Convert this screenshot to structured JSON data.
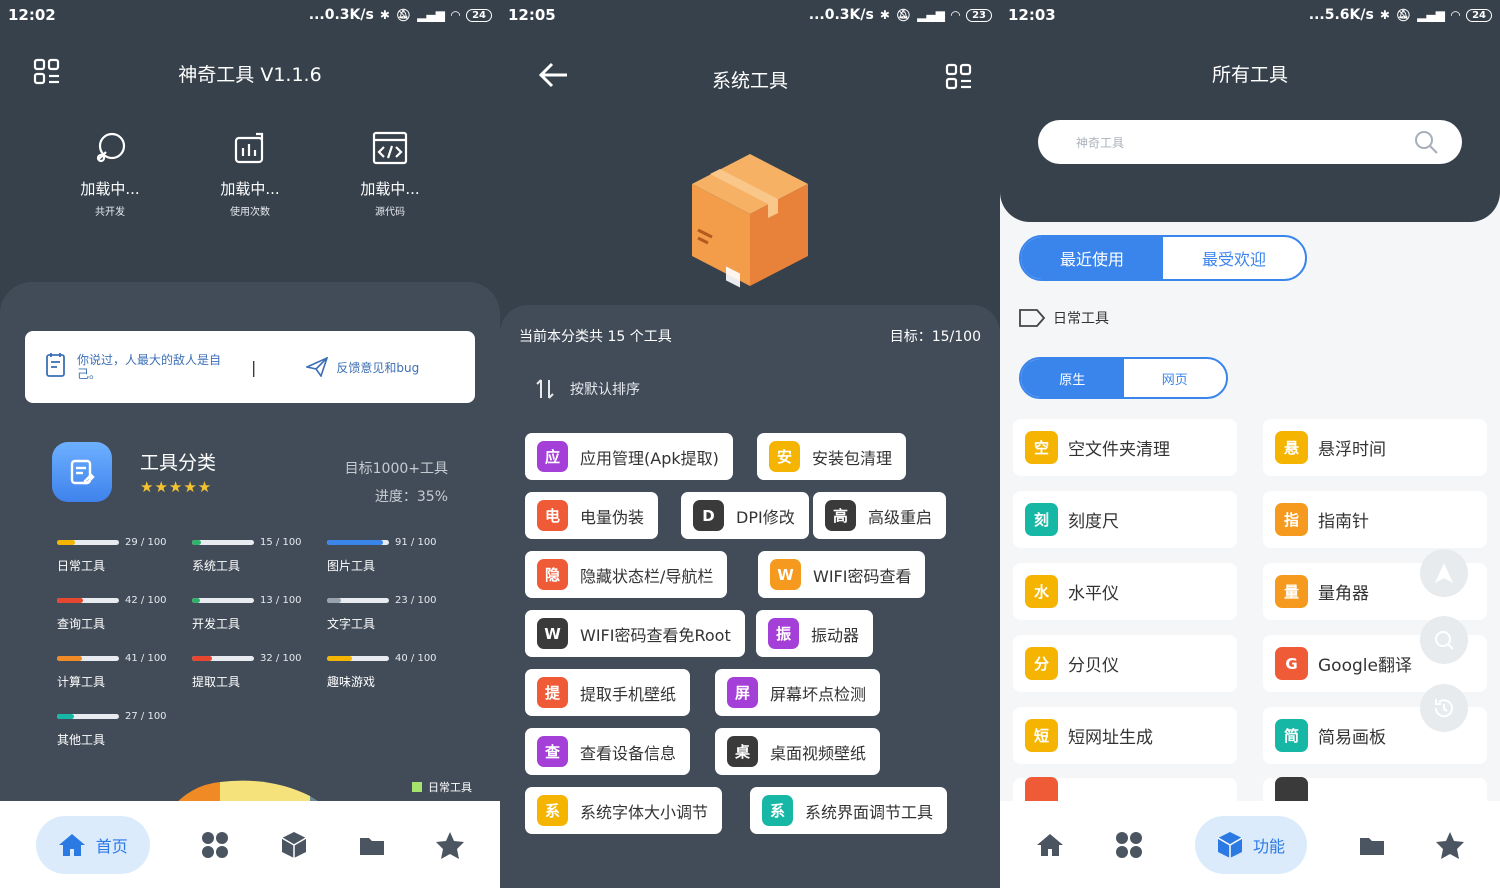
{
  "panel1": {
    "status": {
      "time": "12:02",
      "speed": "...0.3K/s",
      "battery": "24"
    },
    "title": "神奇工具 V1.1.6",
    "stats": [
      {
        "value": "加载中...",
        "label": "共开发"
      },
      {
        "value": "加载中...",
        "label": "使用次数"
      },
      {
        "value": "加载中...",
        "label": "源代码"
      }
    ],
    "quote": "你说过，人最大的敌人是自己。",
    "divider": "|",
    "feedback": "反馈意见和bug",
    "category_title": "工具分类",
    "stars": "★★★★★",
    "goal": "目标1000+工具",
    "progress": "进度：35%",
    "categories": [
      {
        "name": "日常工具",
        "count": "29 / 100",
        "fraction": 0.29,
        "color": "#f4b400"
      },
      {
        "name": "系统工具",
        "count": "15 / 100",
        "fraction": 0.15,
        "color": "#2fb36a"
      },
      {
        "name": "图片工具",
        "count": "91 / 100",
        "fraction": 0.91,
        "color": "#3a85ec"
      },
      {
        "name": "查询工具",
        "count": "42 / 100",
        "fraction": 0.42,
        "color": "#e8472f"
      },
      {
        "name": "开发工具",
        "count": "13 / 100",
        "fraction": 0.13,
        "color": "#2fb36a"
      },
      {
        "name": "文字工具",
        "count": "23 / 100",
        "fraction": 0.23,
        "color": "#9aa3ad"
      },
      {
        "name": "计算工具",
        "count": "41 / 100",
        "fraction": 0.41,
        "color": "#f08a24"
      },
      {
        "name": "提取工具",
        "count": "32 / 100",
        "fraction": 0.32,
        "color": "#e8472f"
      },
      {
        "name": "趣味游戏",
        "count": "40 / 100",
        "fraction": 0.4,
        "color": "#f4b400"
      },
      {
        "name": "其他工具",
        "count": "27 / 100",
        "fraction": 0.27,
        "color": "#17b7a6"
      }
    ],
    "legend": "日常工具",
    "nav_active_label": "首页"
  },
  "panel2": {
    "status": {
      "time": "12:05",
      "speed": "...0.3K/s",
      "battery": "23"
    },
    "title": "系统工具",
    "count_text": "当前本分类共 15 个工具",
    "target_text": "目标：15/100",
    "sort_label": "按默认排序",
    "tools": [
      {
        "badge": "应",
        "label": "应用管理(Apk提取)",
        "color": "#a43fd8"
      },
      {
        "badge": "安",
        "label": "安装包清理",
        "color": "#f4b400"
      },
      {
        "badge": "电",
        "label": "电量伪装",
        "color": "#ef5a37"
      },
      {
        "badge": "D",
        "label": "DPI修改",
        "color": "#3a3a3a"
      },
      {
        "badge": "高",
        "label": "高级重启",
        "color": "#3a3a3a"
      },
      {
        "badge": "隐",
        "label": "隐藏状态栏/导航栏",
        "color": "#ef5a37"
      },
      {
        "badge": "W",
        "label": "WIFI密码查看",
        "color": "#f59a1e"
      },
      {
        "badge": "W",
        "label": "WIFI密码查看免Root",
        "color": "#3a3a3a"
      },
      {
        "badge": "振",
        "label": "振动器",
        "color": "#a43fd8"
      },
      {
        "badge": "提",
        "label": "提取手机壁纸",
        "color": "#ef5a37"
      },
      {
        "badge": "屏",
        "label": "屏幕坏点检测",
        "color": "#a43fd8"
      },
      {
        "badge": "查",
        "label": "查看设备信息",
        "color": "#a43fd8"
      },
      {
        "badge": "桌",
        "label": "桌面视频壁纸",
        "color": "#3a3a3a"
      },
      {
        "badge": "系",
        "label": "系统字体大小调节",
        "color": "#f4b400"
      },
      {
        "badge": "系",
        "label": "系统界面调节工具",
        "color": "#17b7a6"
      }
    ]
  },
  "panel3": {
    "status": {
      "time": "12:03",
      "speed": "...5.6K/s",
      "battery": "24"
    },
    "title": "所有工具",
    "search_placeholder": "神奇工具",
    "tab_recent": "最近使用",
    "tab_popular": "最受欢迎",
    "section": "日常工具",
    "sub_native": "原生",
    "sub_web": "网页",
    "tools": [
      {
        "badge": "空",
        "label": "空文件夹清理",
        "color": "#f4b400"
      },
      {
        "badge": "悬",
        "label": "悬浮时间",
        "color": "#f4b400"
      },
      {
        "badge": "刻",
        "label": "刻度尺",
        "color": "#17b7a6"
      },
      {
        "badge": "指",
        "label": "指南针",
        "color": "#f59a1e"
      },
      {
        "badge": "水",
        "label": "水平仪",
        "color": "#f4b400"
      },
      {
        "badge": "量",
        "label": "量角器",
        "color": "#f59a1e"
      },
      {
        "badge": "分",
        "label": "分贝仪",
        "color": "#f4b400"
      },
      {
        "badge": "G",
        "label": "Google翻译",
        "color": "#ef5a37"
      },
      {
        "badge": "短",
        "label": "短网址生成",
        "color": "#f4b400"
      },
      {
        "badge": "简",
        "label": "简易画板",
        "color": "#17b7a6"
      }
    ],
    "nav_active_label": "功能"
  },
  "colors": {
    "dark": "#37414b",
    "sheet": "#424c58",
    "accent": "#3a85ec"
  }
}
